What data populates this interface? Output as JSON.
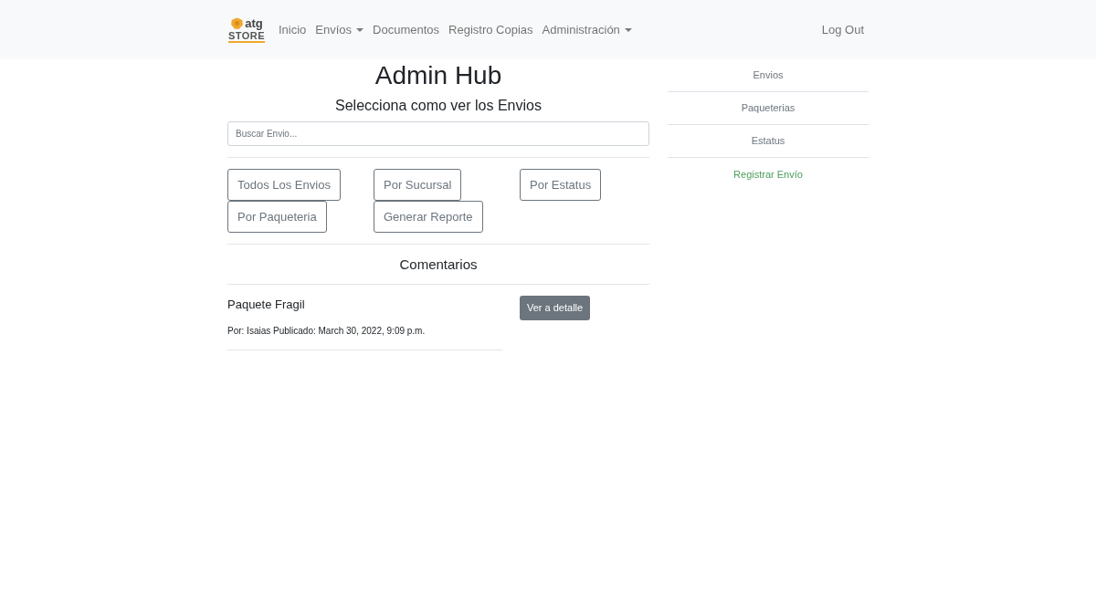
{
  "navbar": {
    "logo": {
      "line_1": "atg",
      "line_2": "STORE"
    },
    "links": [
      {
        "label": "Inicio",
        "dropdown": false
      },
      {
        "label": "Envíos",
        "dropdown": true
      },
      {
        "label": "Documentos",
        "dropdown": false
      },
      {
        "label": "Registro Copias",
        "dropdown": false
      },
      {
        "label": "Administración",
        "dropdown": true
      }
    ],
    "logout": "Log Out"
  },
  "main": {
    "title": "Admin Hub",
    "subtitle": "Selecciona como ver los Envios",
    "search": {
      "placeholder": "Buscar Envio..."
    },
    "buttons": [
      "Todos Los Envios",
      "Por Sucursal",
      "Por Estatus",
      "Por Paqueteria",
      "Generar Reporte"
    ],
    "comments_title": "Comentarios",
    "comments": [
      {
        "title": "Paquete Fragil",
        "meta": "Por: Isaias Publicado: March 30, 2022, 9:09 p.m.",
        "button": "Ver a detalle"
      }
    ]
  },
  "sidebar": {
    "items": [
      {
        "label": "Envios",
        "kind": "link"
      },
      {
        "label": "Paqueterias",
        "kind": "link"
      },
      {
        "label": "Estatus",
        "kind": "link"
      },
      {
        "label": "Registrar Envío",
        "kind": "action"
      }
    ]
  }
}
